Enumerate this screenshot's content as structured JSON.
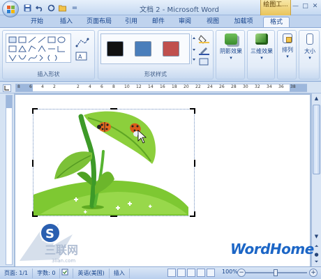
{
  "title_bar": {
    "title": "文档 2 - Microsoft Word",
    "context_tab_header": "绘图工...",
    "window_controls": [
      "—",
      "□",
      "✕"
    ]
  },
  "quick_access": {
    "icons": [
      "save-icon",
      "undo-icon",
      "redo-icon",
      "open-icon",
      "dropdown-icon"
    ],
    "separator": "="
  },
  "tabs": [
    {
      "label": "开始"
    },
    {
      "label": "插入"
    },
    {
      "label": "页面布局"
    },
    {
      "label": "引用"
    },
    {
      "label": "邮件"
    },
    {
      "label": "审阅"
    },
    {
      "label": "视图"
    },
    {
      "label": "加载项"
    },
    {
      "label": "格式",
      "active": true
    }
  ],
  "ribbon": {
    "insert_shapes": {
      "label": "插入形状"
    },
    "shape_styles": {
      "label": "形状样式",
      "swatches": [
        "#111111",
        "#4a7ebb",
        "#c0504d"
      ]
    },
    "shadow_effects": {
      "label": "阴影效果"
    },
    "three_d_effects": {
      "label": "三维效果"
    },
    "arrange": {
      "label": "排列"
    },
    "size": {
      "label": "大小"
    }
  },
  "ruler": {
    "labels": [
      "8",
      "6",
      "4",
      "2",
      "",
      "2",
      "4",
      "6",
      "8",
      "10",
      "12",
      "14",
      "16",
      "18",
      "20",
      "22",
      "24",
      "26",
      "28",
      "30",
      "32",
      "34",
      "36",
      "38"
    ]
  },
  "watermarks": {
    "left": "S",
    "left_text": "三联网",
    "left_url": "3lian.com",
    "right": "WordHome"
  },
  "status_bar": {
    "page": "页面: 1/1",
    "words": "字数: 0",
    "language": "英语(美国)",
    "mode": "插入",
    "zoom": "100%",
    "zoom_minus": "−",
    "zoom_plus": "+"
  }
}
